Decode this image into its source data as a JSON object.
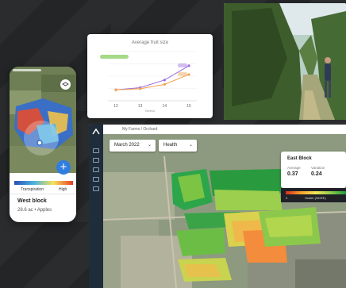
{
  "phone": {
    "gradient_labels": {
      "left": "Transpiration",
      "right": "High"
    },
    "block_title": "West block",
    "block_subtitle": "28.6 ac • Apples",
    "fab_label": "+"
  },
  "fruit_chart": {
    "title": "Average fruit size",
    "x_label": "Weeks",
    "tick_labels": [
      "12",
      "13",
      "14",
      "15"
    ]
  },
  "chart_data": {
    "type": "line",
    "title": "Average fruit size",
    "xlabel": "Weeks",
    "ylabel": "",
    "x": [
      12,
      13,
      14,
      15
    ],
    "series": [
      {
        "name": "",
        "values": [
          1.0,
          1.2,
          1.9,
          3.2
        ],
        "color": "#9b6be0"
      },
      {
        "name": "",
        "values": [
          1.0,
          1.1,
          1.5,
          2.4
        ],
        "color": "#f3a04b"
      }
    ],
    "ylim": [
      0,
      4.5
    ],
    "grid": true
  },
  "dashboard": {
    "breadcrumb": "My Farms / Orchard",
    "date_select": "March 2022",
    "metric_select": "Health",
    "block_card": {
      "title": "East Block",
      "stats": [
        {
          "label": "Average",
          "value": "0.37"
        },
        {
          "label": "Variation",
          "value": "0.24"
        }
      ]
    },
    "legend": {
      "min": "0",
      "label": "Health (NDRE)"
    }
  },
  "colors": {
    "background": "#232527",
    "sidebar": "#1f2c3a",
    "accent": "#2f7de1"
  }
}
